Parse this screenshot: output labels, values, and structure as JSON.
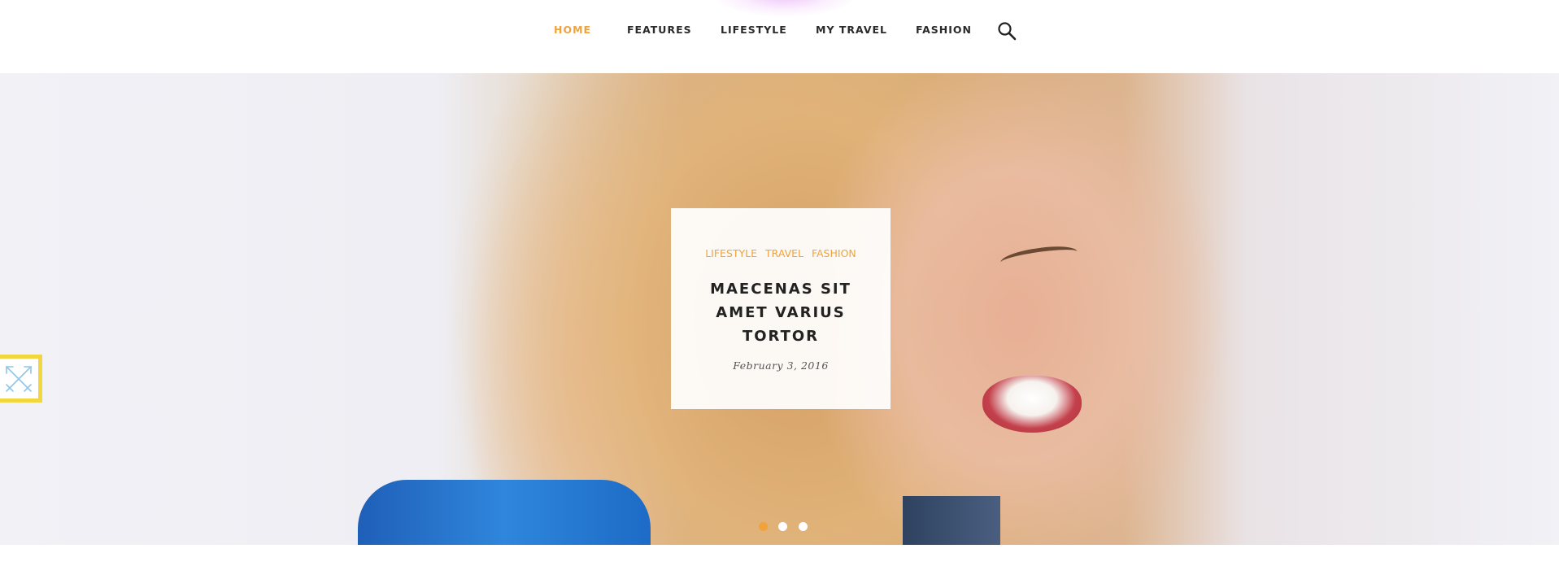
{
  "nav": {
    "items": [
      {
        "label": "HOME",
        "active": true
      },
      {
        "label": "FEATURES",
        "active": false
      },
      {
        "label": "LIFESTYLE",
        "active": false
      },
      {
        "label": "MY TRAVEL",
        "active": false
      },
      {
        "label": "FASHION",
        "active": false
      }
    ],
    "search_icon": "search-icon"
  },
  "hero": {
    "card": {
      "categories": [
        "LIFESTYLE",
        "TRAVEL",
        "FASHION"
      ],
      "title": "MAECENAS SIT AMET VARIUS TORTOR",
      "date": "February 3, 2016"
    },
    "slider": {
      "total_slides": 3,
      "active_slide": 1
    }
  },
  "side_badge": {
    "icon": "crossed-arrows-icon"
  },
  "colors": {
    "accent": "#f0a33c",
    "text": "#2a2a2a",
    "badge_border": "#f2d63f"
  }
}
